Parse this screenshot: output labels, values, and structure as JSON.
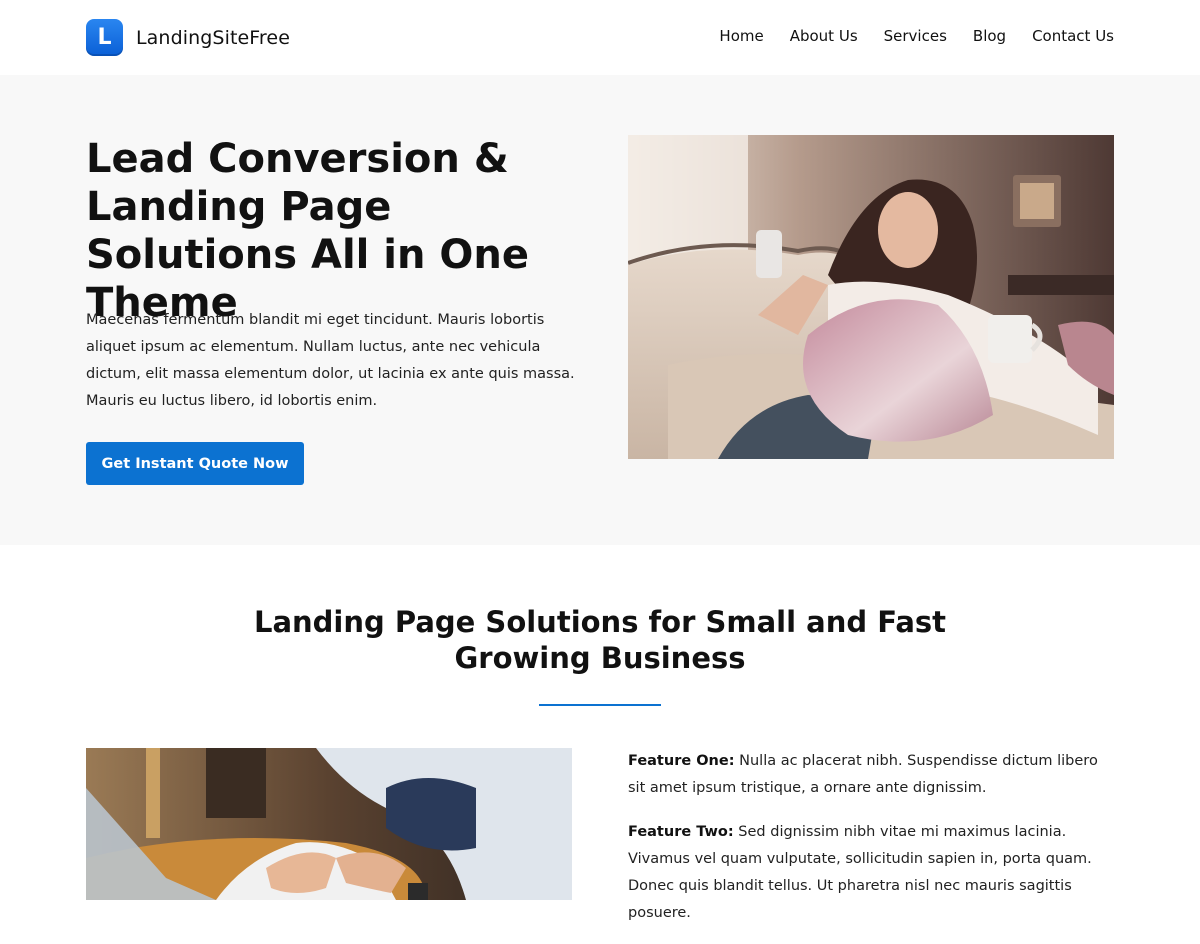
{
  "brand": {
    "logo_letter": "L",
    "name": "LandingSiteFree",
    "accent": "#0c72d1"
  },
  "nav": [
    "Home",
    "About Us",
    "Services",
    "Blog",
    "Contact Us"
  ],
  "hero": {
    "title": "Lead Conversion & Landing Page Solutions All in One Theme",
    "text": "Maecenas fermentum blandit mi eget tincidunt. Mauris lobortis aliquet ipsum ac elementum. Nullam luctus, ante nec vehicula dictum, elit massa elementum dolor, ut lacinia ex ante quis massa. Mauris eu luctus libero, id lobortis enim.",
    "cta_label": "Get Instant Quote Now",
    "image_alt": "Woman on a sofa holding a phone and a mug"
  },
  "section": {
    "title": "Landing Page Solutions for Small and Fast Growing Business",
    "image_alt": "Person typing on a laptop",
    "features": [
      {
        "label": "Feature One:",
        "text": "Nulla ac placerat nibh. Suspendisse dictum libero sit amet ipsum tristique, a ornare ante dignissim."
      },
      {
        "label": "Feature Two:",
        "text": "Sed dignissim nibh vitae mi maximus lacinia. Vivamus vel quam vulputate, sollicitudin sapien in, porta quam. Donec quis blandit tellus. Ut pharetra nisl nec mauris sagittis posuere."
      }
    ]
  }
}
